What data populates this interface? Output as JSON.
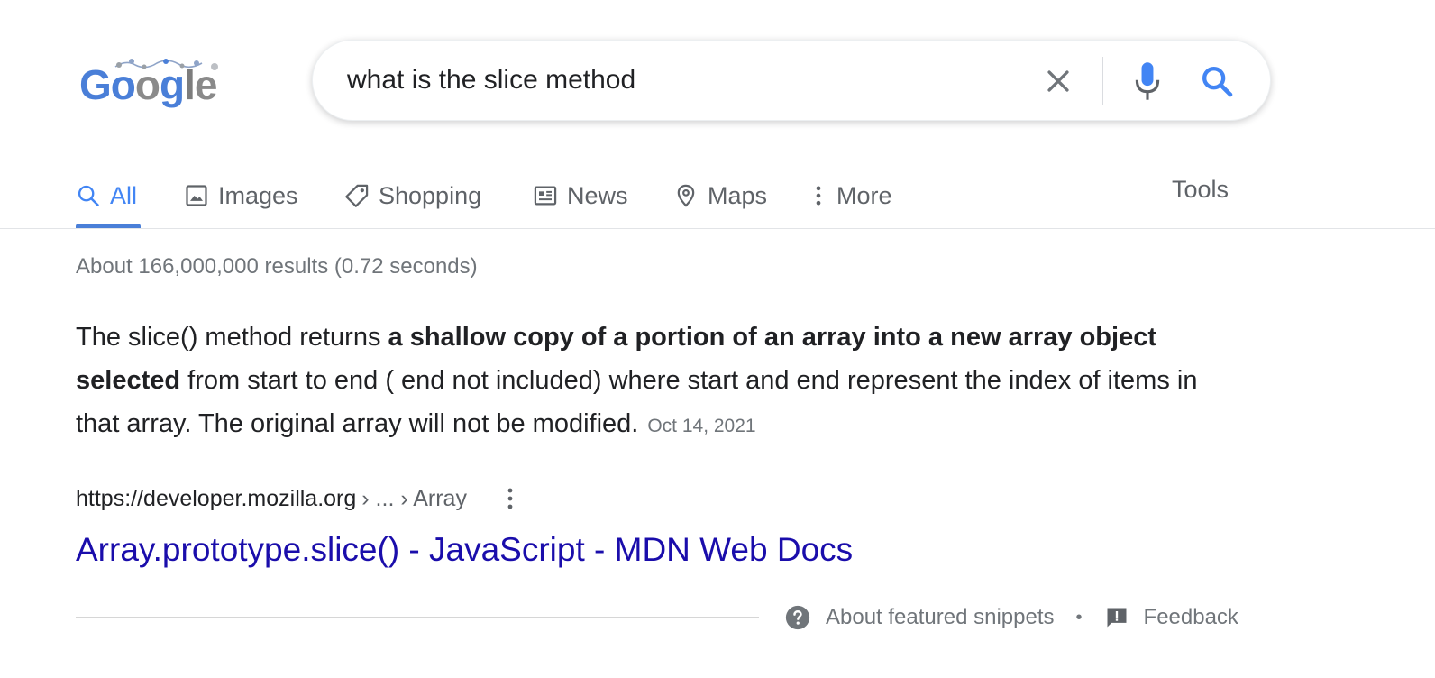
{
  "header": {
    "logo_alt": "Google",
    "search": {
      "value": "what is the slice method",
      "placeholder": ""
    },
    "icons": {
      "clear": "close-icon",
      "voice": "microphone-icon",
      "search": "search-icon"
    }
  },
  "tabs": {
    "items": [
      {
        "label": "All",
        "icon": "search-icon",
        "active": true
      },
      {
        "label": "Images",
        "icon": "image-icon"
      },
      {
        "label": "Shopping",
        "icon": "tag-icon"
      },
      {
        "label": "News",
        "icon": "newspaper-icon"
      },
      {
        "label": "Maps",
        "icon": "map-pin-icon"
      },
      {
        "label": "More",
        "icon": "vertical-dots-icon"
      }
    ],
    "tools_label": "Tools"
  },
  "results": {
    "stats": "About 166,000,000 results (0.72 seconds)",
    "featured_snippet": {
      "text_before": "The slice() method returns ",
      "text_bold_1": "a shallow copy of a portion of an array into a new array object selected",
      "text_after": " from start to end ( end not included) where start and end represent the index of items in that array. The original array will not be modified.",
      "date": "Oct 14, 2021",
      "cite_domain": "https://developer.mozilla.org",
      "cite_path": "› ... › Array",
      "title": "Array.prototype.slice() - JavaScript - MDN Web Docs"
    },
    "footer": {
      "about_label": "About featured snippets",
      "separator": "•",
      "feedback_label": "Feedback"
    }
  },
  "colors": {
    "accent_blue": "#4285f4",
    "link_blue": "#1a0dab",
    "muted_gray": "#70757a",
    "text": "#202124"
  }
}
